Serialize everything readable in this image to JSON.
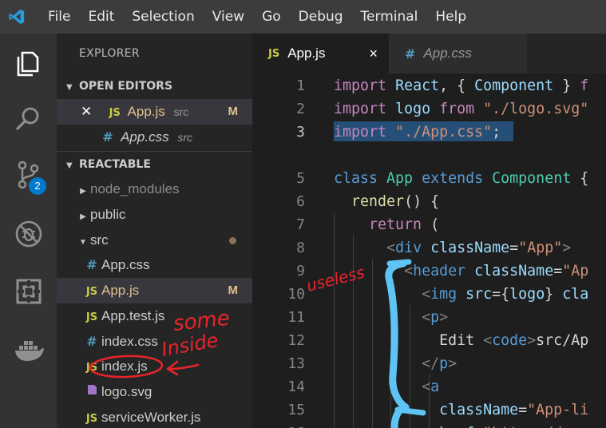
{
  "menu": [
    "File",
    "Edit",
    "Selection",
    "View",
    "Go",
    "Debug",
    "Terminal",
    "Help"
  ],
  "activity": {
    "scm_badge": "2"
  },
  "sidebar": {
    "title": "EXPLORER",
    "open_editors": {
      "label": "OPEN EDITORS",
      "items": [
        {
          "icon": "JS",
          "name": "App.js",
          "desc": "src",
          "status": "M"
        },
        {
          "icon": "#",
          "name": "App.css",
          "desc": "src"
        }
      ]
    },
    "project": {
      "label": "REACTABLE",
      "items": [
        {
          "name": "node_modules",
          "kind": "folder"
        },
        {
          "name": "public",
          "kind": "folder"
        },
        {
          "name": "src",
          "kind": "folder-open"
        },
        {
          "icon": "#",
          "name": "App.css"
        },
        {
          "icon": "JS",
          "name": "App.js",
          "status": "M"
        },
        {
          "icon": "JS",
          "name": "App.test.js"
        },
        {
          "icon": "#",
          "name": "index.css"
        },
        {
          "icon": "JS",
          "name": "index.js"
        },
        {
          "icon": "svg",
          "name": "logo.svg"
        },
        {
          "icon": "JS",
          "name": "serviceWorker.js"
        }
      ]
    }
  },
  "tabs": [
    {
      "icon": "JS",
      "label": "App.js",
      "close": "×"
    },
    {
      "icon": "#",
      "label": "App.css"
    }
  ],
  "editor": {
    "line_numbers": [
      "1",
      "2",
      "3",
      "",
      "5",
      "6",
      "7",
      "8",
      "9",
      "10",
      "11",
      "12",
      "13",
      "14",
      "15",
      "16"
    ],
    "current_line": "3"
  },
  "annotations": {
    "useless": "useless",
    "some": "some",
    "inside": "Inside"
  },
  "colors": {
    "accent": "#007acc",
    "annotation_red": "#e8242b",
    "annotation_blue": "#5ec4f5"
  }
}
